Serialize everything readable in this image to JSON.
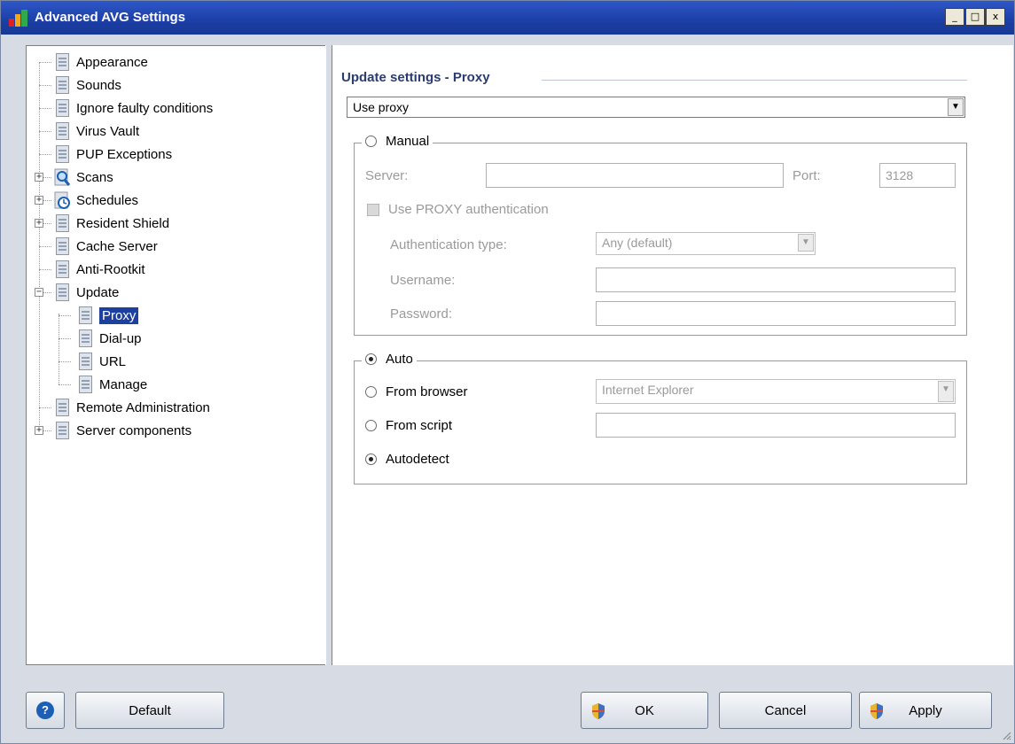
{
  "window": {
    "title": "Advanced AVG Settings",
    "controls": {
      "minimize": "_",
      "maximize": "□",
      "close": "x"
    }
  },
  "tree": [
    {
      "label": "Appearance",
      "icon": "settings-page-icon",
      "expandable": false
    },
    {
      "label": "Sounds",
      "icon": "settings-page-icon",
      "expandable": false
    },
    {
      "label": "Ignore faulty conditions",
      "icon": "settings-page-icon",
      "expandable": false
    },
    {
      "label": "Virus Vault",
      "icon": "settings-page-icon",
      "expandable": false
    },
    {
      "label": "PUP Exceptions",
      "icon": "settings-page-icon",
      "expandable": false
    },
    {
      "label": "Scans",
      "icon": "magnifier-icon",
      "expandable": true,
      "expanded": false
    },
    {
      "label": "Schedules",
      "icon": "schedule-icon",
      "expandable": true,
      "expanded": false
    },
    {
      "label": "Resident Shield",
      "icon": "settings-page-icon",
      "expandable": true,
      "expanded": false
    },
    {
      "label": "Cache Server",
      "icon": "settings-page-icon",
      "expandable": false
    },
    {
      "label": "Anti-Rootkit",
      "icon": "settings-page-icon",
      "expandable": false
    },
    {
      "label": "Update",
      "icon": "settings-page-icon",
      "expandable": true,
      "expanded": true
    },
    {
      "label": "Proxy",
      "icon": "settings-page-icon",
      "child": true,
      "selected": true
    },
    {
      "label": "Dial-up",
      "icon": "settings-page-icon",
      "child": true
    },
    {
      "label": "URL",
      "icon": "settings-page-icon",
      "child": true
    },
    {
      "label": "Manage",
      "icon": "settings-page-icon",
      "child": true
    },
    {
      "label": "Remote Administration",
      "icon": "settings-page-icon",
      "expandable": false
    },
    {
      "label": "Server components",
      "icon": "settings-page-icon",
      "expandable": true,
      "expanded": false
    }
  ],
  "proxy": {
    "section_title": "Update settings - Proxy",
    "mode_select": "Use proxy",
    "manual": {
      "label": "Manual",
      "checked": false,
      "server_label": "Server:",
      "server_value": "",
      "port_label": "Port:",
      "port_value": "3128",
      "auth_checkbox_label": "Use PROXY authentication",
      "auth_type_label": "Authentication type:",
      "auth_type_value": "Any (default)",
      "username_label": "Username:",
      "username_value": "",
      "password_label": "Password:",
      "password_value": ""
    },
    "auto": {
      "label": "Auto",
      "checked": true,
      "from_browser_label": "From browser",
      "from_browser_value": "Internet Explorer",
      "from_script_label": "From script",
      "from_script_value": "",
      "autodetect_label": "Autodetect",
      "selected_option": "Autodetect"
    }
  },
  "buttons": {
    "help": "?",
    "default": "Default",
    "ok": "OK",
    "cancel": "Cancel",
    "apply": "Apply"
  },
  "colors": {
    "titlebar": "#1c3ea6",
    "selection": "#1d3f9f",
    "section_title": "#2a3c70",
    "window_bg": "#d6dbe4"
  }
}
